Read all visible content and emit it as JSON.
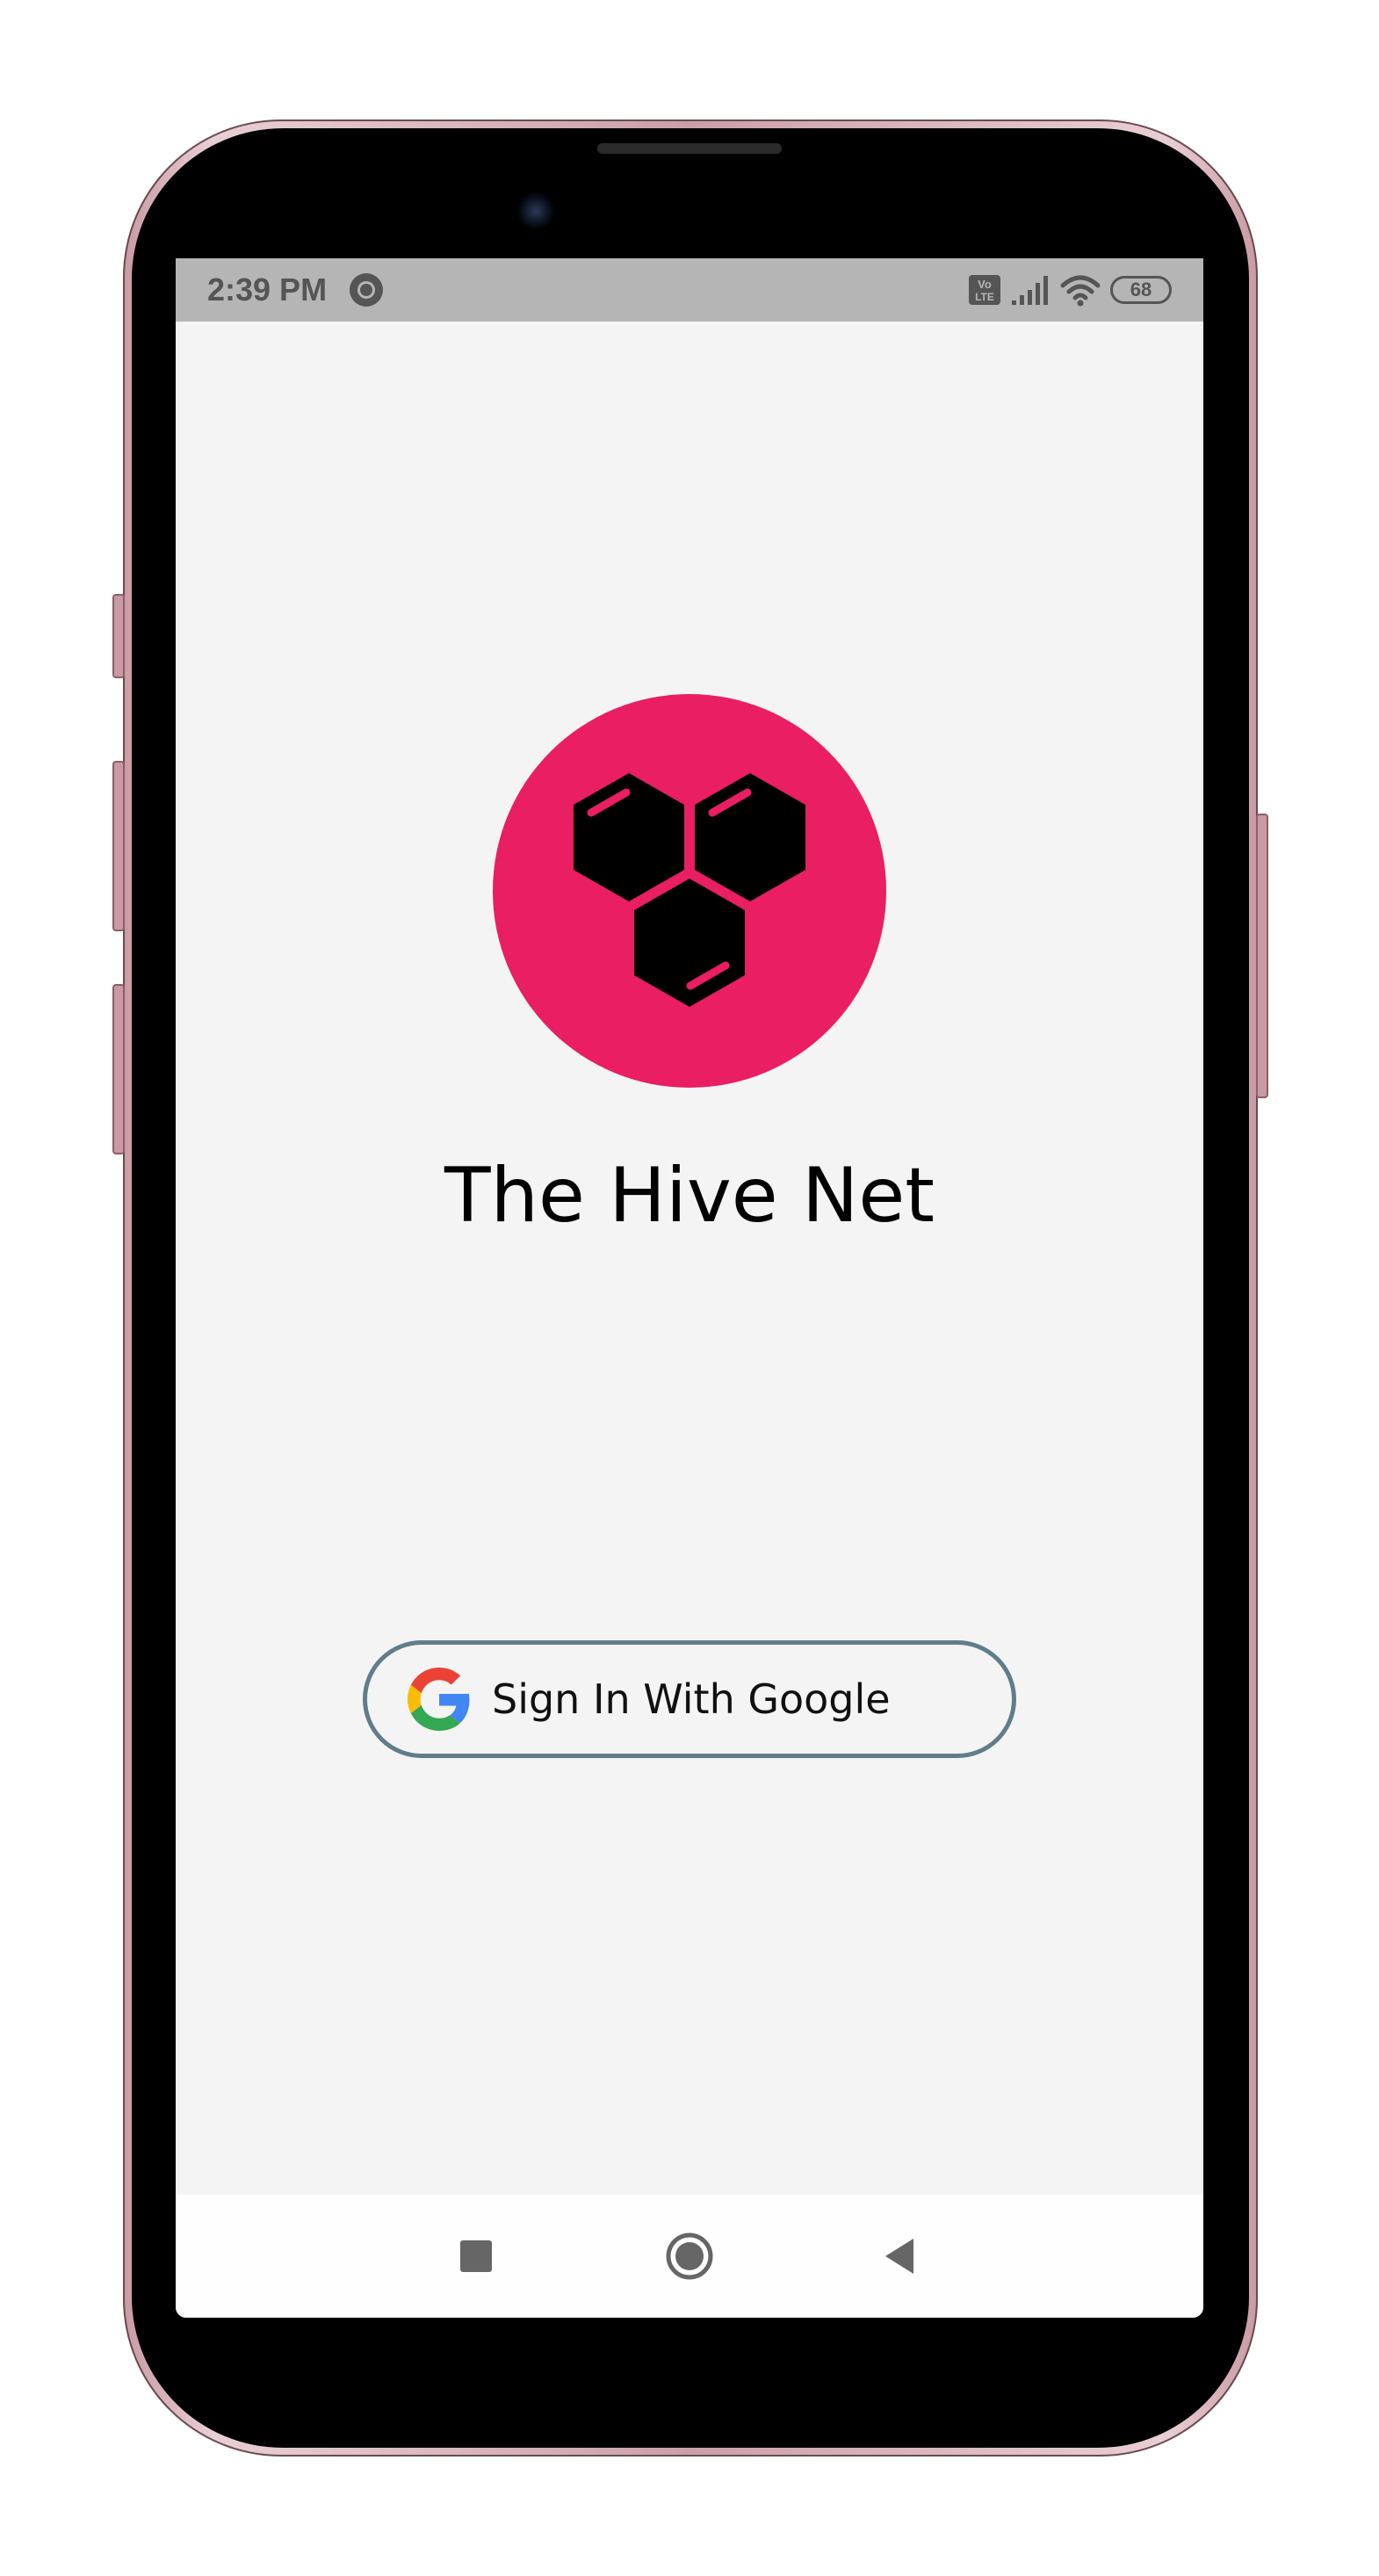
{
  "status_bar": {
    "time": "2:39 PM",
    "battery": "68",
    "icons": [
      "volte-icon",
      "signal-icon",
      "wifi-icon",
      "battery-icon"
    ]
  },
  "app": {
    "title": "The Hive Net",
    "brand_color": "#e91e63",
    "logo": "hive-hexagons-icon"
  },
  "sign_in": {
    "label": "Sign In With Google",
    "border_color": "#607d8b",
    "icon": "google-icon"
  },
  "navigation": {
    "buttons": [
      "recents-button",
      "home-button",
      "back-button"
    ]
  }
}
